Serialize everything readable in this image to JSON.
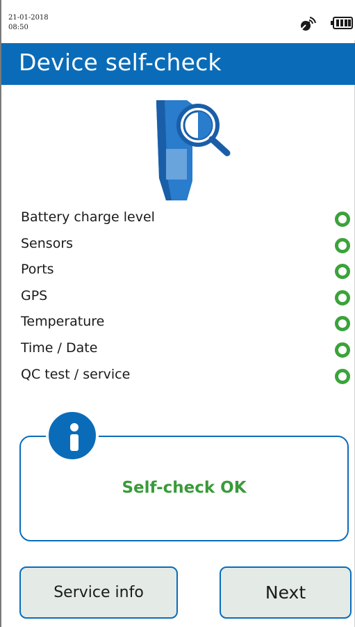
{
  "status_bar": {
    "date": "21-01-2018",
    "time": "08:50",
    "signal_icon": "satellite-signal-icon",
    "battery_icon": "battery-full-icon"
  },
  "header": {
    "title": "Device self-check"
  },
  "device_icon": "device-search-icon",
  "checks": [
    {
      "label": "Battery charge level",
      "status": "ok"
    },
    {
      "label": "Sensors",
      "status": "ok"
    },
    {
      "label": "Ports",
      "status": "ok"
    },
    {
      "label": "GPS",
      "status": "ok"
    },
    {
      "label": "Temperature",
      "status": "ok"
    },
    {
      "label": "Time / Date",
      "status": "ok"
    },
    {
      "label": "QC test / service",
      "status": "ok"
    }
  ],
  "info": {
    "icon": "info-icon",
    "message": "Self-check OK"
  },
  "buttons": {
    "service_info": "Service info",
    "next": "Next"
  },
  "colors": {
    "brand_blue": "#0a6cb8",
    "ok_green": "#3aa33a",
    "button_bg": "#e4eae6"
  }
}
